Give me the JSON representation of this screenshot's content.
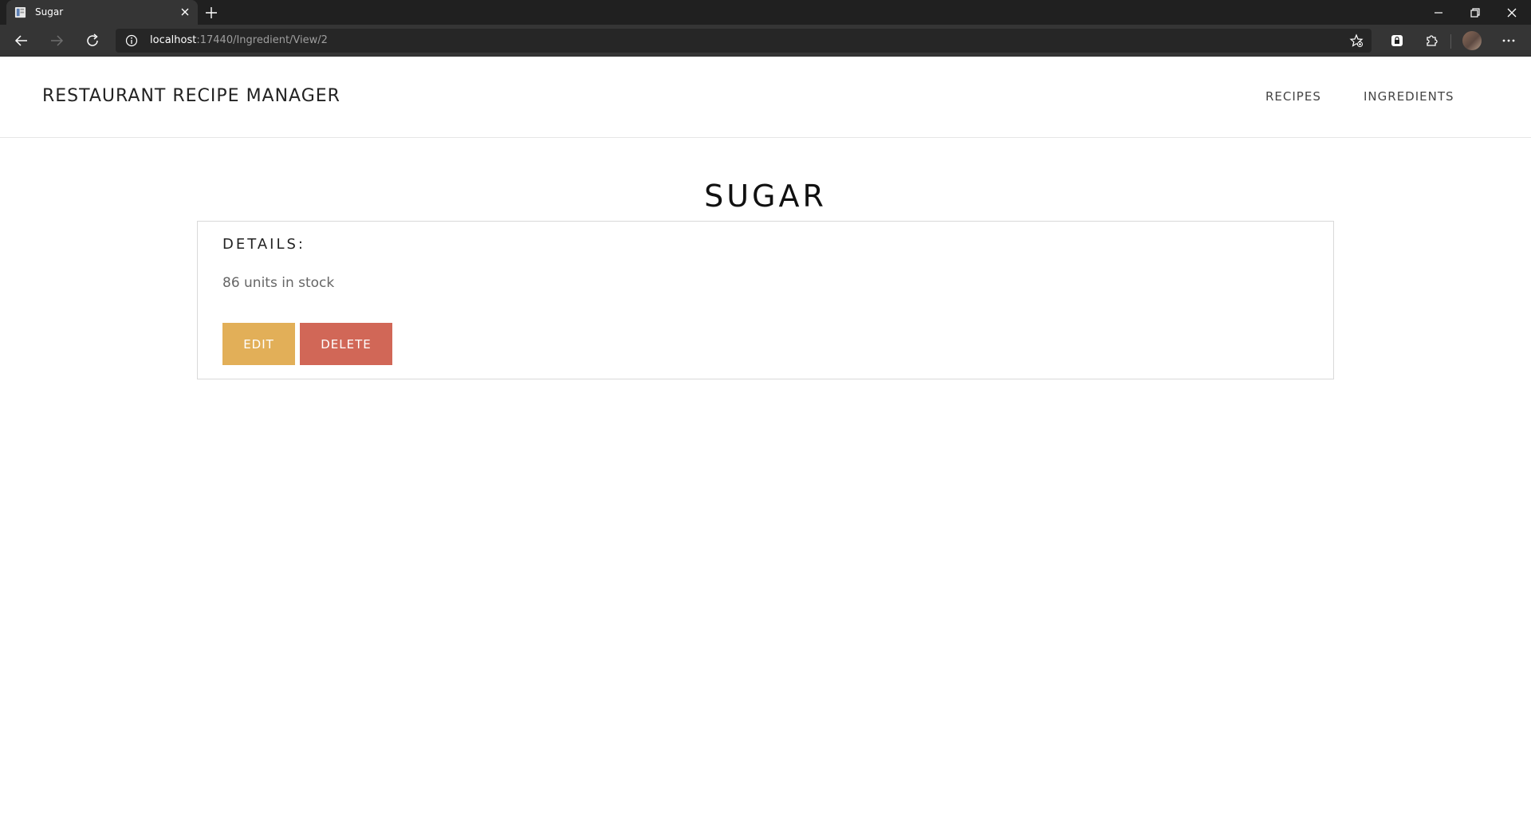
{
  "browser": {
    "tab_title": "Sugar",
    "url_host": "localhost",
    "url_rest": ":17440/Ingredient/View/2"
  },
  "header": {
    "brand": "RESTAURANT RECIPE MANAGER",
    "nav": [
      {
        "label": "RECIPES"
      },
      {
        "label": "INGREDIENTS"
      }
    ]
  },
  "ingredient": {
    "title": "SUGAR",
    "details_heading": "DETAILS:",
    "stock_text": "86 units in stock"
  },
  "actions": {
    "edit_label": "EDIT",
    "delete_label": "DELETE"
  },
  "colors": {
    "edit_button": "#E2AF58",
    "delete_button": "#D16757",
    "chrome_dark": "#202020",
    "toolbar": "#353535"
  }
}
